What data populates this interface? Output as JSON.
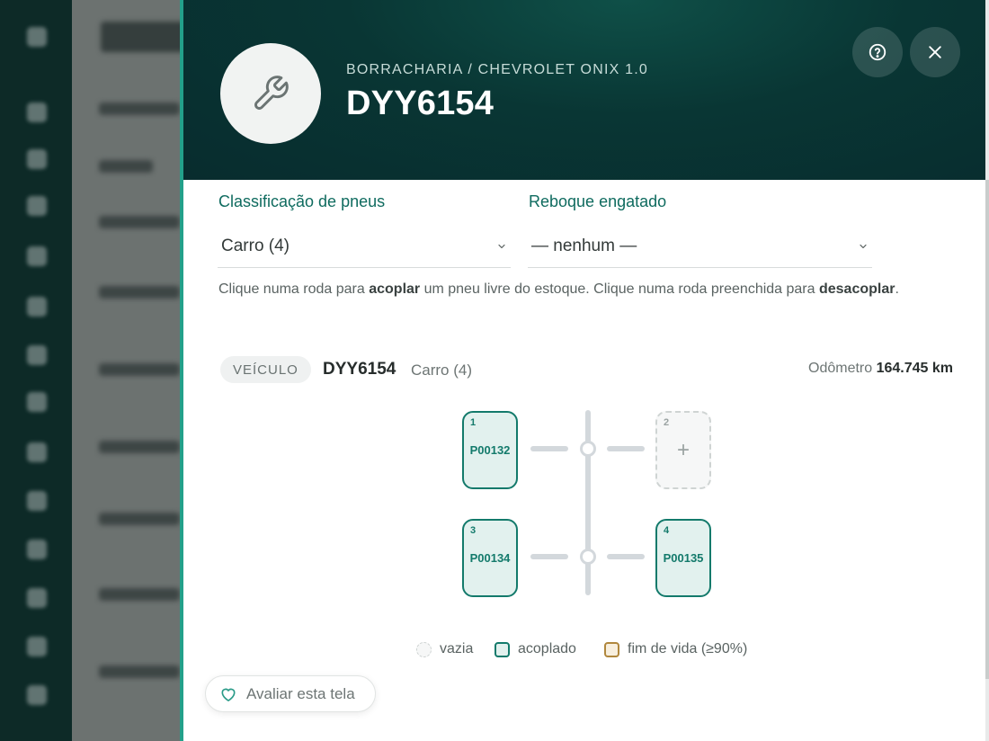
{
  "header": {
    "breadcrumb": "BORRACHARIA / CHEVROLET ONIX 1.0",
    "title": "DYY6154",
    "icons": {
      "avatar": "wrench-icon",
      "help": "question-circle-icon",
      "close": "close-icon"
    }
  },
  "form": {
    "classification_label": "Classificação de pneus",
    "classification_value": "Carro (4)",
    "trailer_label": "Reboque engatado",
    "trailer_value": "— nenhum —"
  },
  "hint": {
    "part1": "Clique numa roda para ",
    "bold1": "acoplar",
    "part2": " um pneu livre do estoque. Clique numa roda preenchida para ",
    "bold2": "desacoplar",
    "part3": "."
  },
  "vehicle": {
    "badge": "VEÍCULO",
    "plate": "DYY6154",
    "classification": "Carro (4)",
    "odometer_label": "Odômetro",
    "odometer_value": "164.745 km"
  },
  "wheels": [
    {
      "position": "1",
      "tire": "P00132",
      "state": "acoplado"
    },
    {
      "position": "2",
      "tire": "",
      "state": "vazia",
      "icon": "plus-icon"
    },
    {
      "position": "3",
      "tire": "P00134",
      "state": "acoplado"
    },
    {
      "position": "4",
      "tire": "P00135",
      "state": "acoplado"
    }
  ],
  "legend": {
    "empty": "vazia",
    "attached": "acoplado",
    "end_of_life": "fim de vida (≥90%)"
  },
  "feedback": {
    "label": "Avaliar esta tela",
    "icon": "heart-icon"
  },
  "colors": {
    "header_bg": "#093634",
    "accent": "#137a6b",
    "end_of_life": "#b0873d"
  }
}
